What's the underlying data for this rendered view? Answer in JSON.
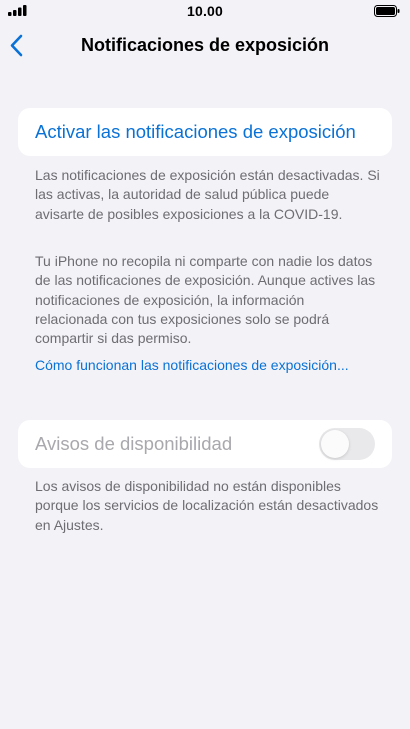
{
  "status_bar": {
    "time": "10.00",
    "signal_icon": "cellular-signal-icon",
    "battery_icon": "battery-full-icon"
  },
  "nav": {
    "title": "Notificaciones de exposición",
    "back_icon": "chevron-left-icon",
    "accent_color": "#0a72d6"
  },
  "activate": {
    "label": "Activar las notificaciones de exposición"
  },
  "descriptions": {
    "status_text": "Las notificaciones de exposición están desactivadas. Si las activas, la autoridad de salud pública puede avisarte de posibles exposiciones a la COVID-19.",
    "privacy_text": "Tu iPhone no recopila ni comparte con nadie los datos de las notificaciones de exposición. Aunque actives las notificaciones de exposición, la información relacionada con tus exposiciones solo se podrá compartir si das permiso."
  },
  "how_it_works": {
    "label": "Cómo funcionan las notificaciones de exposición..."
  },
  "availability": {
    "label": "Avisos de disponibilidad",
    "toggle_on": false,
    "footer": "Los avisos de disponibilidad no están disponibles porque los servicios de localización están desactivados en Ajustes."
  }
}
